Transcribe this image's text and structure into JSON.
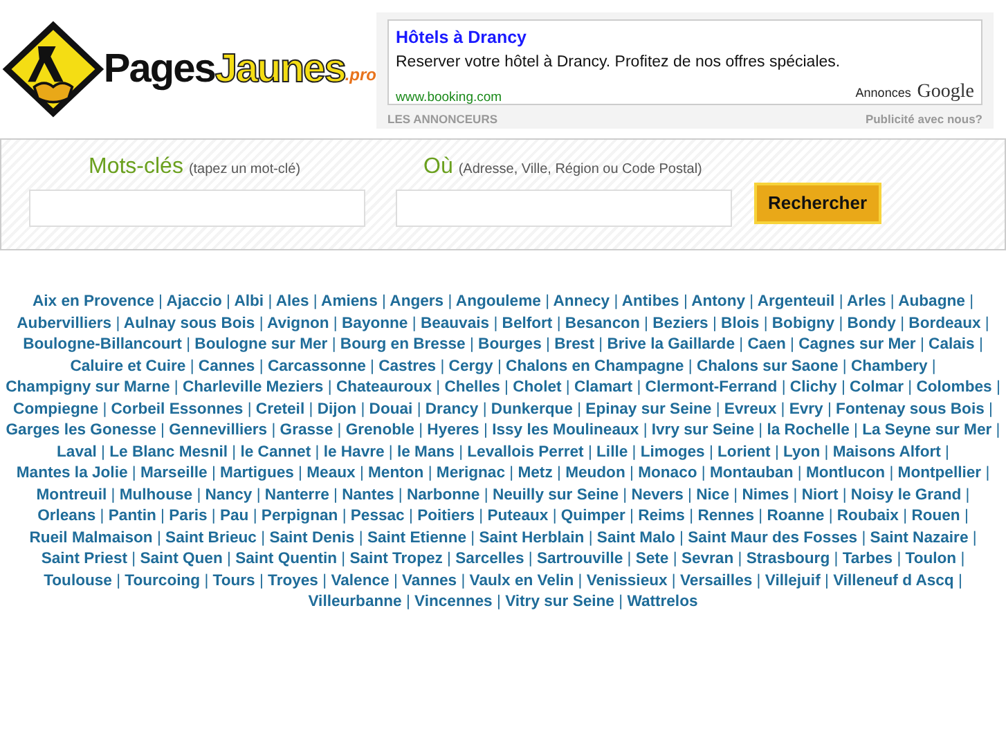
{
  "logo": {
    "word_1": "Pages",
    "word_2": "Jaunes",
    "suffix": ".pro"
  },
  "ad": {
    "title": "Hôtels à Drancy",
    "text": "Reserver votre hôtel à Drancy. Profitez de nos offres spéciales.",
    "url": "www.booking.com",
    "badge_1": "Annonces",
    "badge_2": "Google",
    "footer_left": "LES ANNONCEURS",
    "footer_right": "Publicité avec nous?"
  },
  "search": {
    "fields": [
      {
        "label": "Mots-clés",
        "hint": "(tapez un mot-clé)"
      },
      {
        "label": "Où",
        "hint": "(Adresse, Ville, Région ou Code Postal)"
      }
    ],
    "button": "Rechercher"
  },
  "cities": {
    "separator": "|",
    "items": [
      "Aix en Provence",
      "Ajaccio",
      "Albi",
      "Ales",
      "Amiens",
      "Angers",
      "Angouleme",
      "Annecy",
      "Antibes",
      "Antony",
      "Argenteuil",
      "Arles",
      "Aubagne",
      "Aubervilliers",
      "Aulnay sous Bois",
      "Avignon",
      "Bayonne",
      "Beauvais",
      "Belfort",
      "Besancon",
      "Beziers",
      "Blois",
      "Bobigny",
      "Bondy",
      "Bordeaux",
      "Boulogne-Billancourt",
      "Boulogne sur Mer",
      "Bourg en Bresse",
      "Bourges",
      "Brest",
      "Brive la Gaillarde",
      "Caen",
      "Cagnes sur Mer",
      "Calais",
      "Caluire et Cuire",
      "Cannes",
      "Carcassonne",
      "Castres",
      "Cergy",
      "Chalons en Champagne",
      "Chalons sur Saone",
      "Chambery",
      "Champigny sur Marne",
      "Charleville Meziers",
      "Chateauroux",
      "Chelles",
      "Cholet",
      "Clamart",
      "Clermont-Ferrand",
      "Clichy",
      "Colmar",
      "Colombes",
      "Compiegne",
      "Corbeil Essonnes",
      "Creteil",
      "Dijon",
      "Douai",
      "Drancy",
      "Dunkerque",
      "Epinay sur Seine",
      "Evreux",
      "Evry",
      "Fontenay sous Bois",
      "Garges les Gonesse",
      "Gennevilliers",
      "Grasse",
      "Grenoble",
      "Hyeres",
      "Issy les Moulineaux",
      "Ivry sur Seine",
      "la Rochelle",
      "La Seyne sur Mer",
      "Laval",
      "Le Blanc Mesnil",
      "le Cannet",
      "le Havre",
      "le Mans",
      "Levallois Perret",
      "Lille",
      "Limoges",
      "Lorient",
      "Lyon",
      "Maisons Alfort",
      "Mantes la Jolie",
      "Marseille",
      "Martigues",
      "Meaux",
      "Menton",
      "Merignac",
      "Metz",
      "Meudon",
      "Monaco",
      "Montauban",
      "Montlucon",
      "Montpellier",
      "Montreuil",
      "Mulhouse",
      "Nancy",
      "Nanterre",
      "Nantes",
      "Narbonne",
      "Neuilly sur Seine",
      "Nevers",
      "Nice",
      "Nimes",
      "Niort",
      "Noisy le Grand",
      "Orleans",
      "Pantin",
      "Paris",
      "Pau",
      "Perpignan",
      "Pessac",
      "Poitiers",
      "Puteaux",
      "Quimper",
      "Reims",
      "Rennes",
      "Roanne",
      "Roubaix",
      "Rouen",
      "Rueil Malmaison",
      "Saint Brieuc",
      "Saint Denis",
      "Saint Etienne",
      "Saint Herblain",
      "Saint Malo",
      "Saint Maur des Fosses",
      "Saint Nazaire",
      "Saint Priest",
      "Saint Quen",
      "Saint Quentin",
      "Saint Tropez",
      "Sarcelles",
      "Sartrouville",
      "Sete",
      "Sevran",
      "Strasbourg",
      "Tarbes",
      "Toulon",
      "Toulouse",
      "Tourcoing",
      "Tours",
      "Troyes",
      "Valence",
      "Vannes",
      "Vaulx en Velin",
      "Venissieux",
      "Versailles",
      "Villejuif",
      "Villeneuf d Ascq",
      "Villeurbanne",
      "Vincennes",
      "Vitry sur Seine",
      "Wattrelos"
    ]
  }
}
